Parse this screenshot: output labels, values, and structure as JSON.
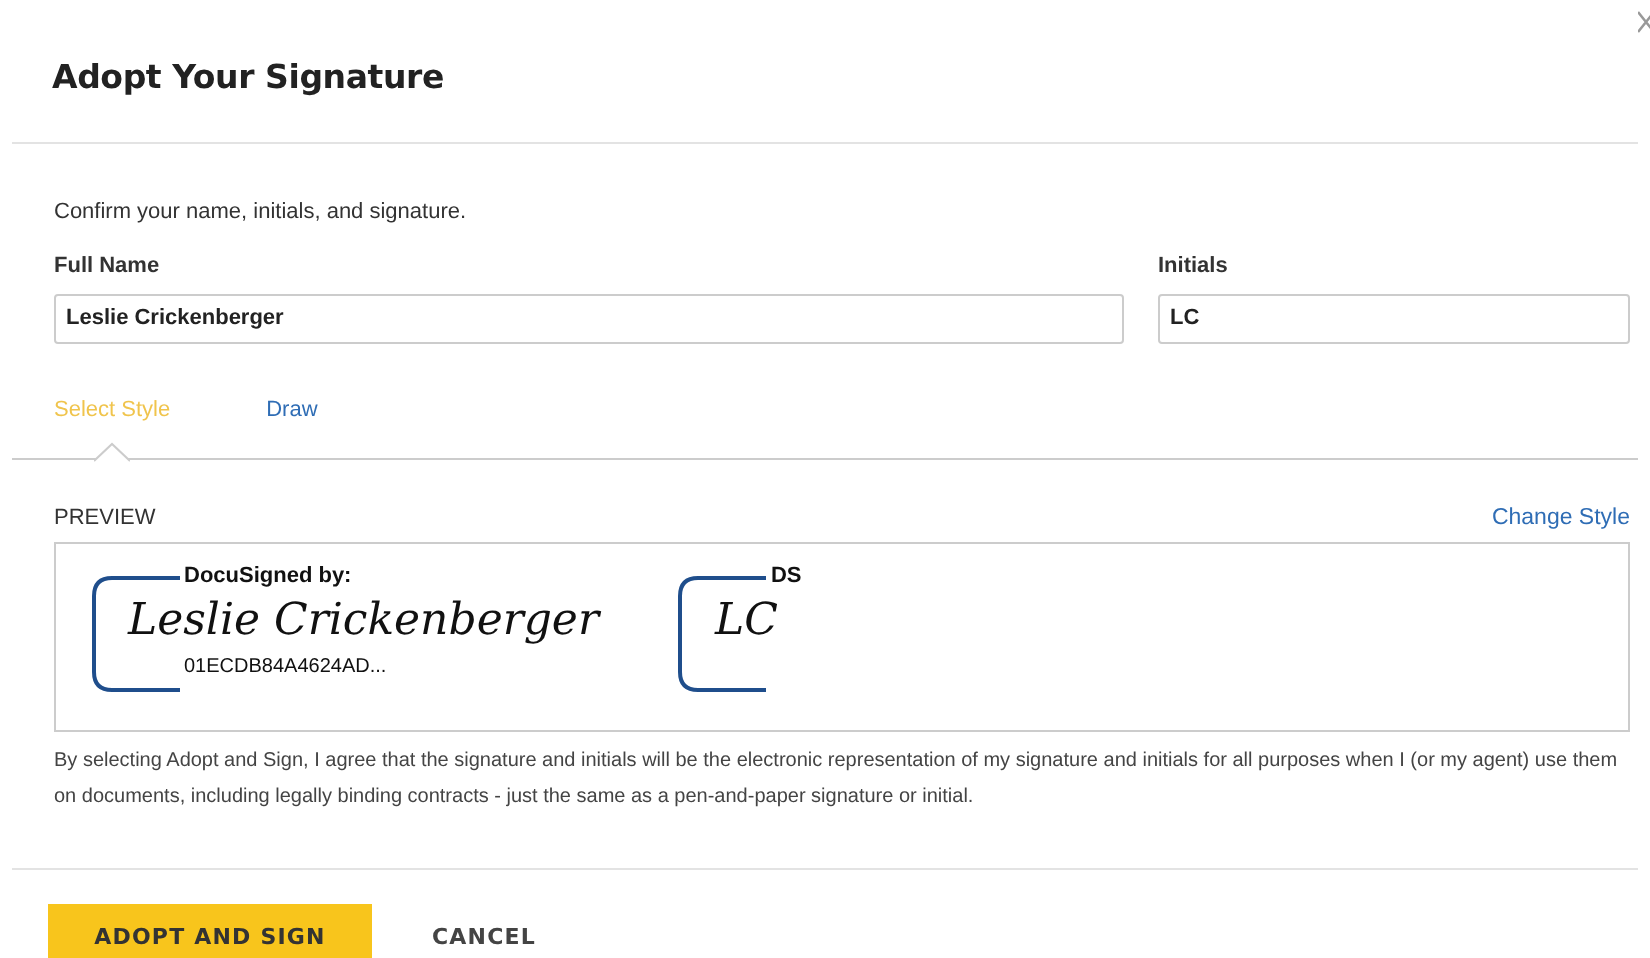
{
  "dialog": {
    "title": "Adopt Your Signature"
  },
  "intro": "Confirm your name, initials, and signature.",
  "fields": [
    {
      "label": "Full Name",
      "value": "Leslie Crickenberger"
    },
    {
      "label": "Initials",
      "value": "LC"
    }
  ],
  "tabs": [
    {
      "label": "Select Style",
      "selected": true
    },
    {
      "label": "Draw",
      "selected": false
    }
  ],
  "preview": {
    "label": "PREVIEW",
    "change_link": "Change Style",
    "stamps": [
      {
        "header": "DocuSigned by:",
        "signature": "Leslie Crickenberger",
        "footer": "01ECDB84A4624AD..."
      },
      {
        "header": "DS",
        "signature": "LC"
      }
    ]
  },
  "disclaimer": "By selecting Adopt and Sign, I agree that the signature and initials will be the electronic representation of my signature and initials for all purposes when I (or my agent) use them on documents, including legally binding contracts - just the same as a pen-and-paper signature or initial.",
  "buttons": [
    {
      "label": "ADOPT AND SIGN",
      "kind": "primary"
    },
    {
      "label": "CANCEL",
      "kind": "secondary"
    }
  ]
}
